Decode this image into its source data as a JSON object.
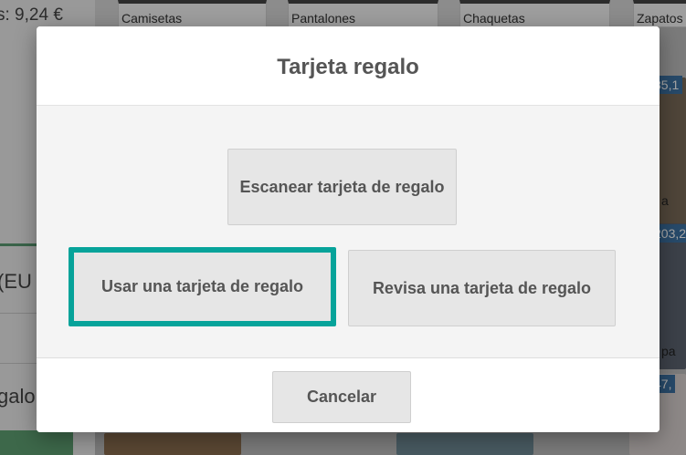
{
  "background": {
    "total_text": "s: 9,24 €",
    "left_partial_1": "(EU",
    "left_partial_2": "galo",
    "categories": [
      "Camisetas",
      "Pantalones",
      "Chaquetas",
      "Zapatos"
    ],
    "price_tags": [
      "85,1",
      "203,2",
      "47,"
    ],
    "product_partial_labels": [
      "a",
      "pa"
    ]
  },
  "modal": {
    "title": "Tarjeta regalo",
    "buttons": {
      "scan": "Escanear tarjeta de regalo",
      "use": "Usar una tarjeta de regalo",
      "review": "Revisa una tarjeta de regalo"
    },
    "selected_button": "use",
    "cancel": "Cancelar"
  },
  "colors": {
    "selection_accent": "#06a39a",
    "price_tag": "#3d72a3",
    "positive_green": "#5ea072"
  }
}
